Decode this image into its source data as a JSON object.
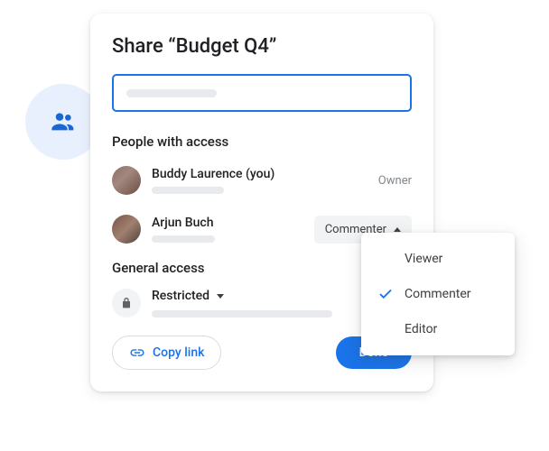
{
  "dialog": {
    "title": "Share “Budget Q4”"
  },
  "sections": {
    "people_with_access": "People with access",
    "general_access": "General access"
  },
  "people": [
    {
      "name": "Buddy Laurence (you)",
      "role": "Owner"
    },
    {
      "name": "Arjun Buch",
      "role": "Commenter"
    }
  ],
  "general": {
    "mode": "Restricted"
  },
  "buttons": {
    "copy_link": "Copy link",
    "done": "Done"
  },
  "dropdown": {
    "options": [
      "Viewer",
      "Commenter",
      "Editor"
    ],
    "selected": "Commenter"
  },
  "icons": {
    "people": "people-icon",
    "lock": "lock-icon",
    "link": "link-icon",
    "check": "check-icon"
  }
}
